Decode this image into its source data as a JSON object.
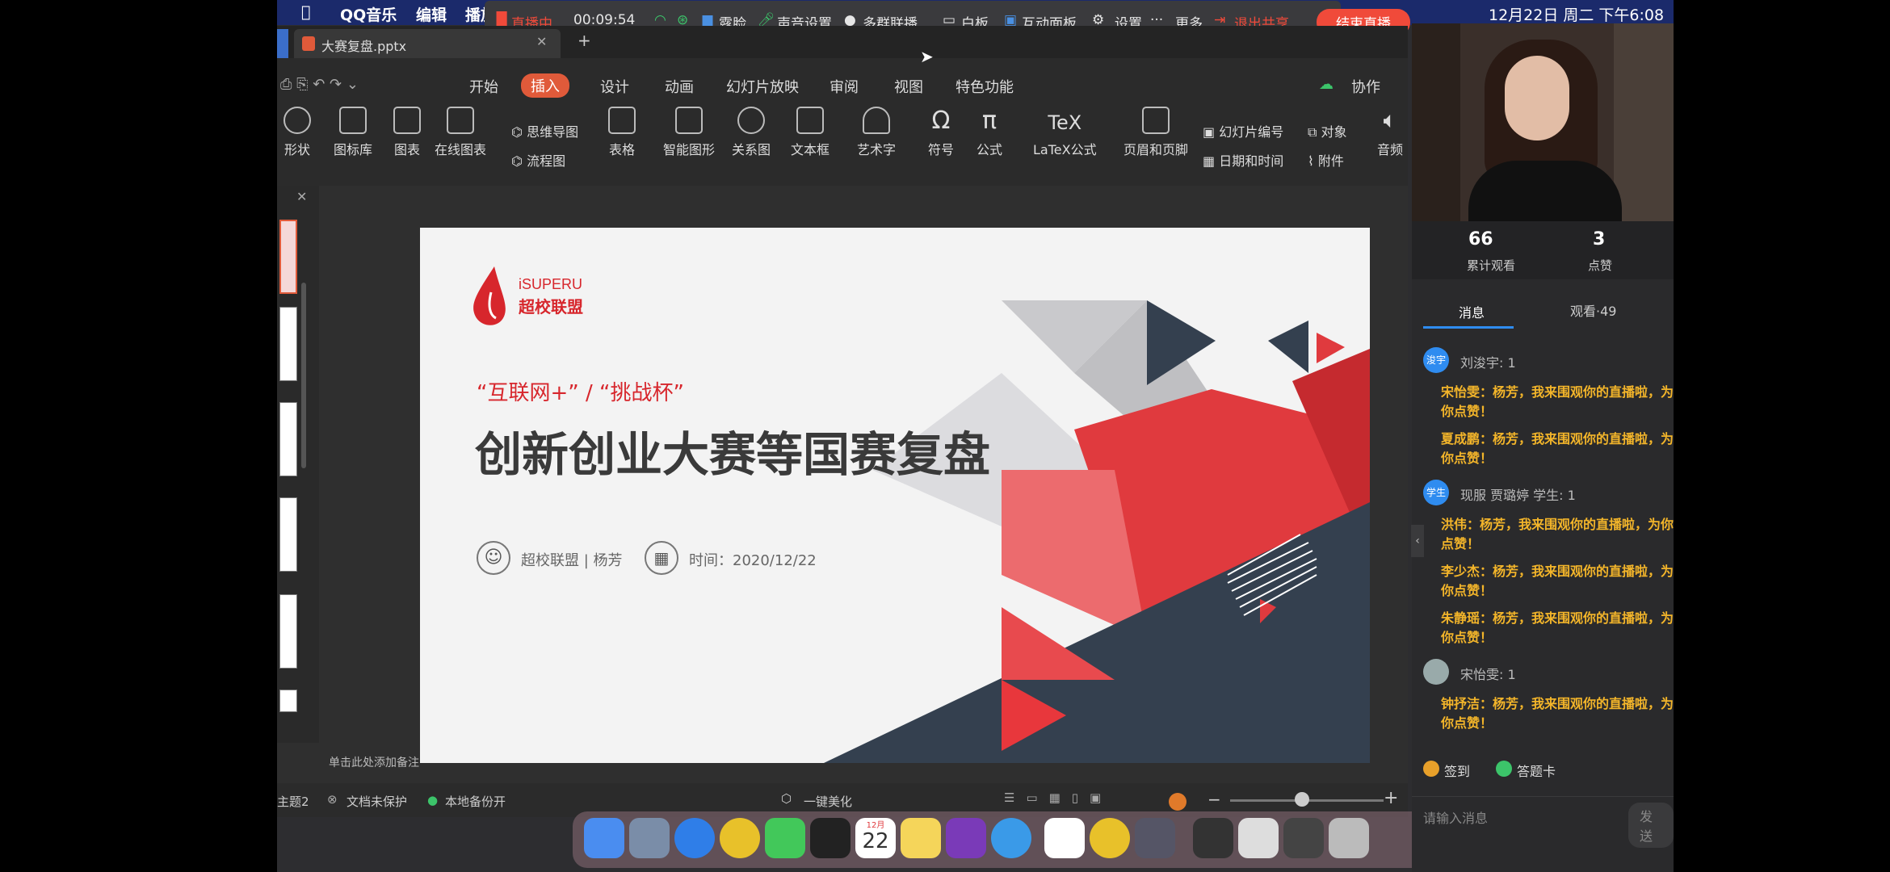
{
  "menubar": {
    "apple": "",
    "app": "QQ音乐",
    "edit": "编辑",
    "play": "播放",
    "datetime": "12月22日 周二 下午6:08"
  },
  "livebar": {
    "status": "直播中",
    "timer": "00:09:54",
    "face": "露脸",
    "audio": "声音设置",
    "multi": "多群联播",
    "whiteboard": "白板",
    "interactive": "互动面板",
    "settings": "设置",
    "more": "更多",
    "exit_share": "退出共享",
    "end_live": "结束直播"
  },
  "wps": {
    "tab_title": "大赛复盘.pptx",
    "add_tab": "+",
    "menus": [
      "开始",
      "插入",
      "设计",
      "动画",
      "幻灯片放映",
      "审阅",
      "视图",
      "特色功能"
    ],
    "collab": "协作",
    "ribbon": {
      "shape": "形状",
      "iconlib": "图标库",
      "chart": "图表",
      "online_chart": "在线图表",
      "mindmap": "思维导图",
      "flowchart": "流程图",
      "table": "表格",
      "smartart": "智能图形",
      "relation": "关系图",
      "textbox": "文本框",
      "wordart": "艺术字",
      "symbol": "符号",
      "formula": "公式",
      "latex": "LaTeX公式",
      "header_footer": "页眉和页脚",
      "slide_number": "幻灯片编号",
      "object": "对象",
      "datetime": "日期和时间",
      "attachment": "附件",
      "audio": "音频"
    },
    "notes": "单击此处添加备注",
    "status": {
      "theme": "主题2",
      "protect": "文档未保护",
      "backup": "本地备份开",
      "beautify": "一键美化"
    }
  },
  "slide": {
    "logo_en": "iSUPERU",
    "logo_cn": "超校联盟",
    "subtitle": "“互联网+” / “挑战杯”",
    "title": "创新创业大赛等国赛复盘",
    "author": "超校联盟 | 杨芳",
    "date": "时间：2020/12/22"
  },
  "panel": {
    "stats": [
      {
        "value": "66",
        "label": "累计观看"
      },
      {
        "value": "3",
        "label": "点赞"
      }
    ],
    "tabs": {
      "messages": "消息",
      "viewers": "观看·49"
    },
    "items": [
      {
        "kind": "sys",
        "avatar": "浚宇",
        "text": "刘浚宇: 1"
      },
      {
        "kind": "msg",
        "text": "宋怡雯：杨芳，我来围观你的直播啦，为你点赞！"
      },
      {
        "kind": "msg",
        "text": "夏成鹏：杨芳，我来围观你的直播啦，为你点赞！"
      },
      {
        "kind": "sys",
        "avatar": "学生",
        "text": "现服 贾璐婷 学生: 1"
      },
      {
        "kind": "msg",
        "text": "洪伟：杨芳，我来围观你的直播啦，为你点赞！"
      },
      {
        "kind": "msg",
        "text": "李少杰：杨芳，我来围观你的直播啦，为你点赞！"
      },
      {
        "kind": "msg",
        "text": "朱静瑶：杨芳，我来围观你的直播啦，为你点赞！"
      },
      {
        "kind": "sys",
        "avatar": "",
        "text": "宋怡雯: 1"
      },
      {
        "kind": "msg",
        "text": "钟抒洁：杨芳，我来围观你的直播啦，为你点赞！"
      }
    ],
    "checkin": "签到",
    "answer_card": "答题卡",
    "input_placeholder": "请输入消息",
    "send": "发送"
  },
  "dock": {
    "calendar_month": "12月",
    "calendar_day": "22"
  },
  "colors": {
    "accent": "#e8483c",
    "live_red": "#f04a3a",
    "slide_red": "#e03a3e",
    "slide_navy": "#34404f",
    "msg_gold": "#f3b52a"
  }
}
